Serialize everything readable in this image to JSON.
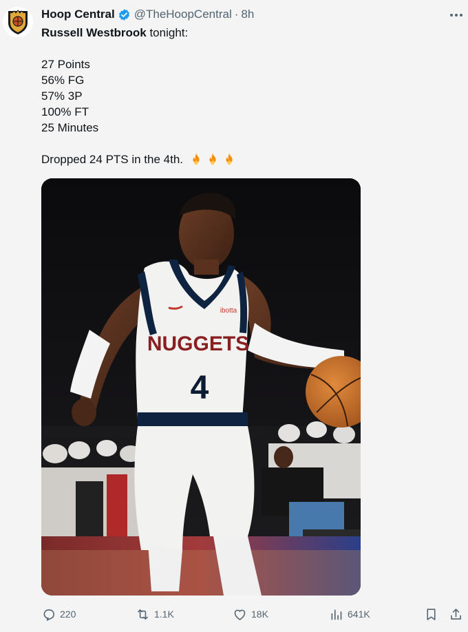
{
  "author": {
    "display_name": "Hoop Central",
    "handle": "@TheHoopCentral",
    "separator": "·",
    "time": "8h",
    "verified": true,
    "avatar_icon": "hoop-central-logo",
    "verified_color": "#1d9bf0"
  },
  "tweet": {
    "subject": "Russell Westbrook",
    "intro_rest": " tonight:",
    "stats": [
      "27 Points",
      "56% FG",
      "57% 3P",
      "100% FT",
      "25 Minutes"
    ],
    "closing": "Dropped 24 PTS in the 4th.",
    "emoji": [
      "fire",
      "fire",
      "fire"
    ]
  },
  "media": {
    "description_icon": "basketball-player-photo",
    "jersey_text": "NUGGETS",
    "jersey_number": "4",
    "sponsor_text": "ibotta"
  },
  "actions": {
    "replies": "220",
    "retweets": "1.1K",
    "likes": "18K",
    "views": "641K"
  },
  "colors": {
    "background": "#f4f4f4",
    "primary_text": "#0f1419",
    "secondary_text": "#536471"
  }
}
